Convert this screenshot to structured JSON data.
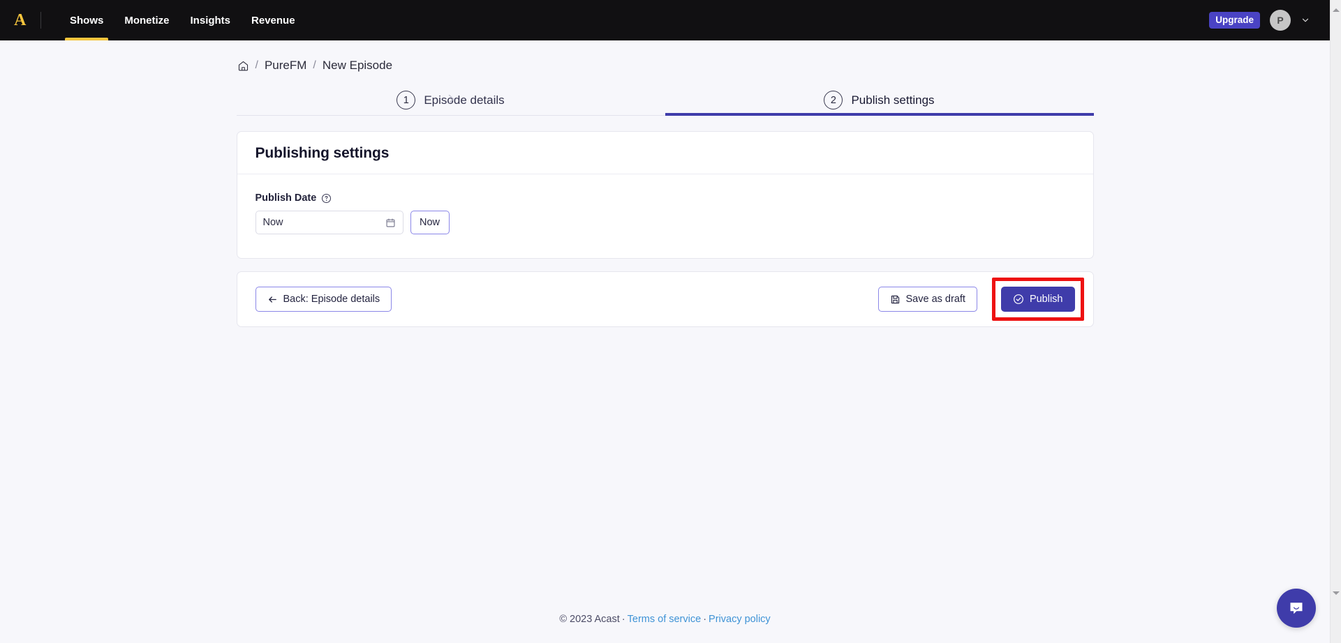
{
  "topnav": {
    "brand_letter": "A",
    "items": [
      {
        "label": "Shows",
        "active": true
      },
      {
        "label": "Monetize",
        "active": false
      },
      {
        "label": "Insights",
        "active": false
      },
      {
        "label": "Revenue",
        "active": false
      }
    ],
    "upgrade_label": "Upgrade",
    "avatar_initial": "P",
    "accent_yellow": "#f5c53d",
    "upgrade_bg": "#4a43c4"
  },
  "breadcrumb": {
    "home_icon": "home-icon",
    "separator": "/",
    "show_name": "PureFM",
    "current": "New Episode"
  },
  "stepper": {
    "steps": [
      {
        "number": "1",
        "label": "Episode details",
        "active": false
      },
      {
        "number": "2",
        "label": "Publish settings",
        "active": true
      }
    ],
    "active_color": "#3f3caa"
  },
  "card": {
    "title": "Publishing settings",
    "publish_date": {
      "label": "Publish Date",
      "help_icon": "question-circle-icon",
      "input_value": "Now",
      "input_placeholder": "Now",
      "calendar_icon": "calendar-icon",
      "now_button": "Now"
    }
  },
  "actions": {
    "back_label": "Back: Episode details",
    "back_icon": "arrow-left-icon",
    "save_draft_label": "Save as draft",
    "save_draft_icon": "floppy-disk-icon",
    "publish_label": "Publish",
    "publish_icon": "check-circle-icon",
    "publish_bg": "#3f3caa",
    "highlight_color": "#ee1111"
  },
  "footer": {
    "copyright": "© 2023 Acast",
    "dot": "·",
    "terms": "Terms of service",
    "privacy": "Privacy policy",
    "link_color": "#3f93d6"
  },
  "chat": {
    "icon": "chat-bubble-icon",
    "bg": "#3f3caa"
  }
}
